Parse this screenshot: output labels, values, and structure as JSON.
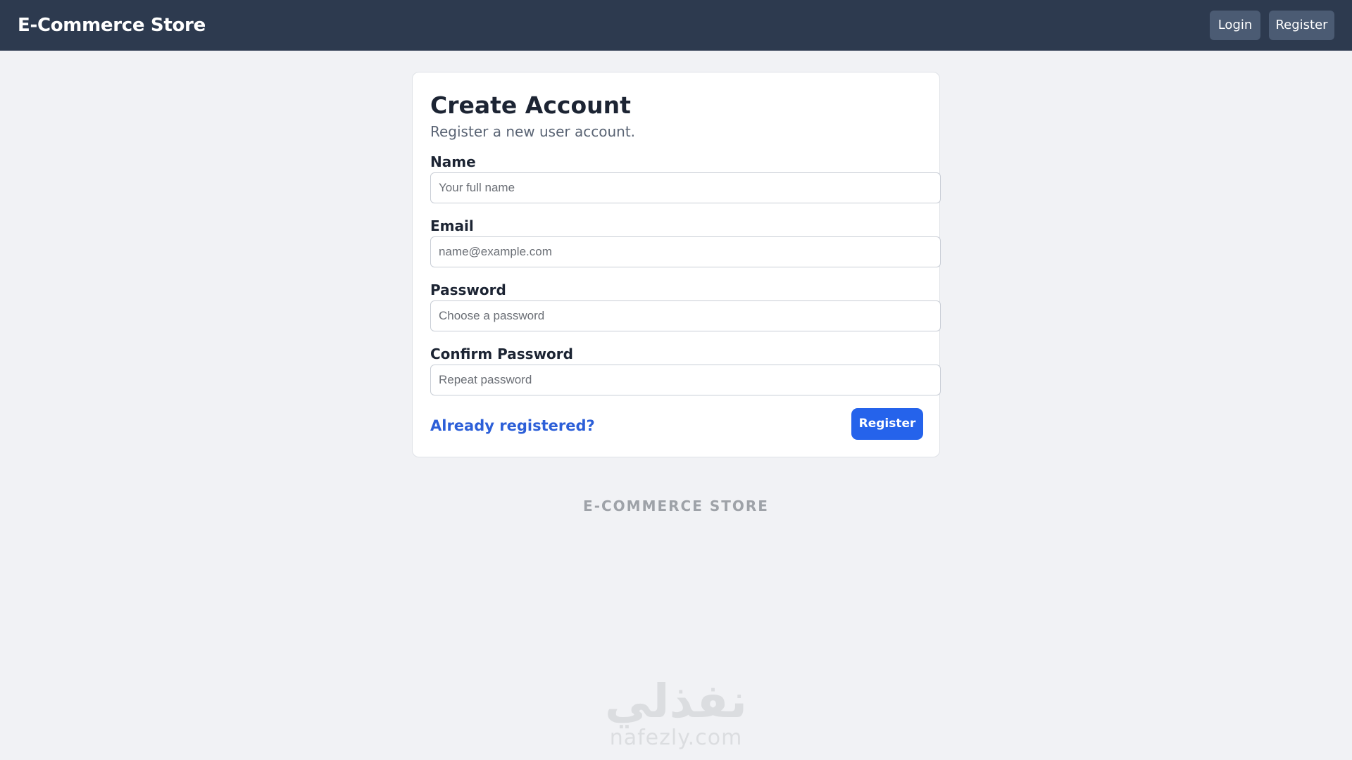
{
  "header": {
    "brand": "E-Commerce Store",
    "login_label": "Login",
    "register_label": "Register"
  },
  "form": {
    "title": "Create Account",
    "subtitle": "Register a new user account.",
    "fields": [
      {
        "label": "Name",
        "placeholder": "Your full name",
        "value": ""
      },
      {
        "label": "Email",
        "placeholder": "name@example.com",
        "value": ""
      },
      {
        "label": "Password",
        "placeholder": "Choose a password",
        "value": ""
      },
      {
        "label": "Confirm Password",
        "placeholder": "Repeat password",
        "value": ""
      }
    ],
    "login_link": "Already registered?",
    "submit_label": "Register"
  },
  "footer": {
    "brand": "E-COMMERCE STORE"
  },
  "watermark": {
    "arabic": "نفذلي",
    "latin": "nafezly.com"
  },
  "colors": {
    "header_bg": "#2d3a4f",
    "page_bg": "#f1f2f5",
    "accent": "#2563eb",
    "link": "#2c5fd8"
  }
}
